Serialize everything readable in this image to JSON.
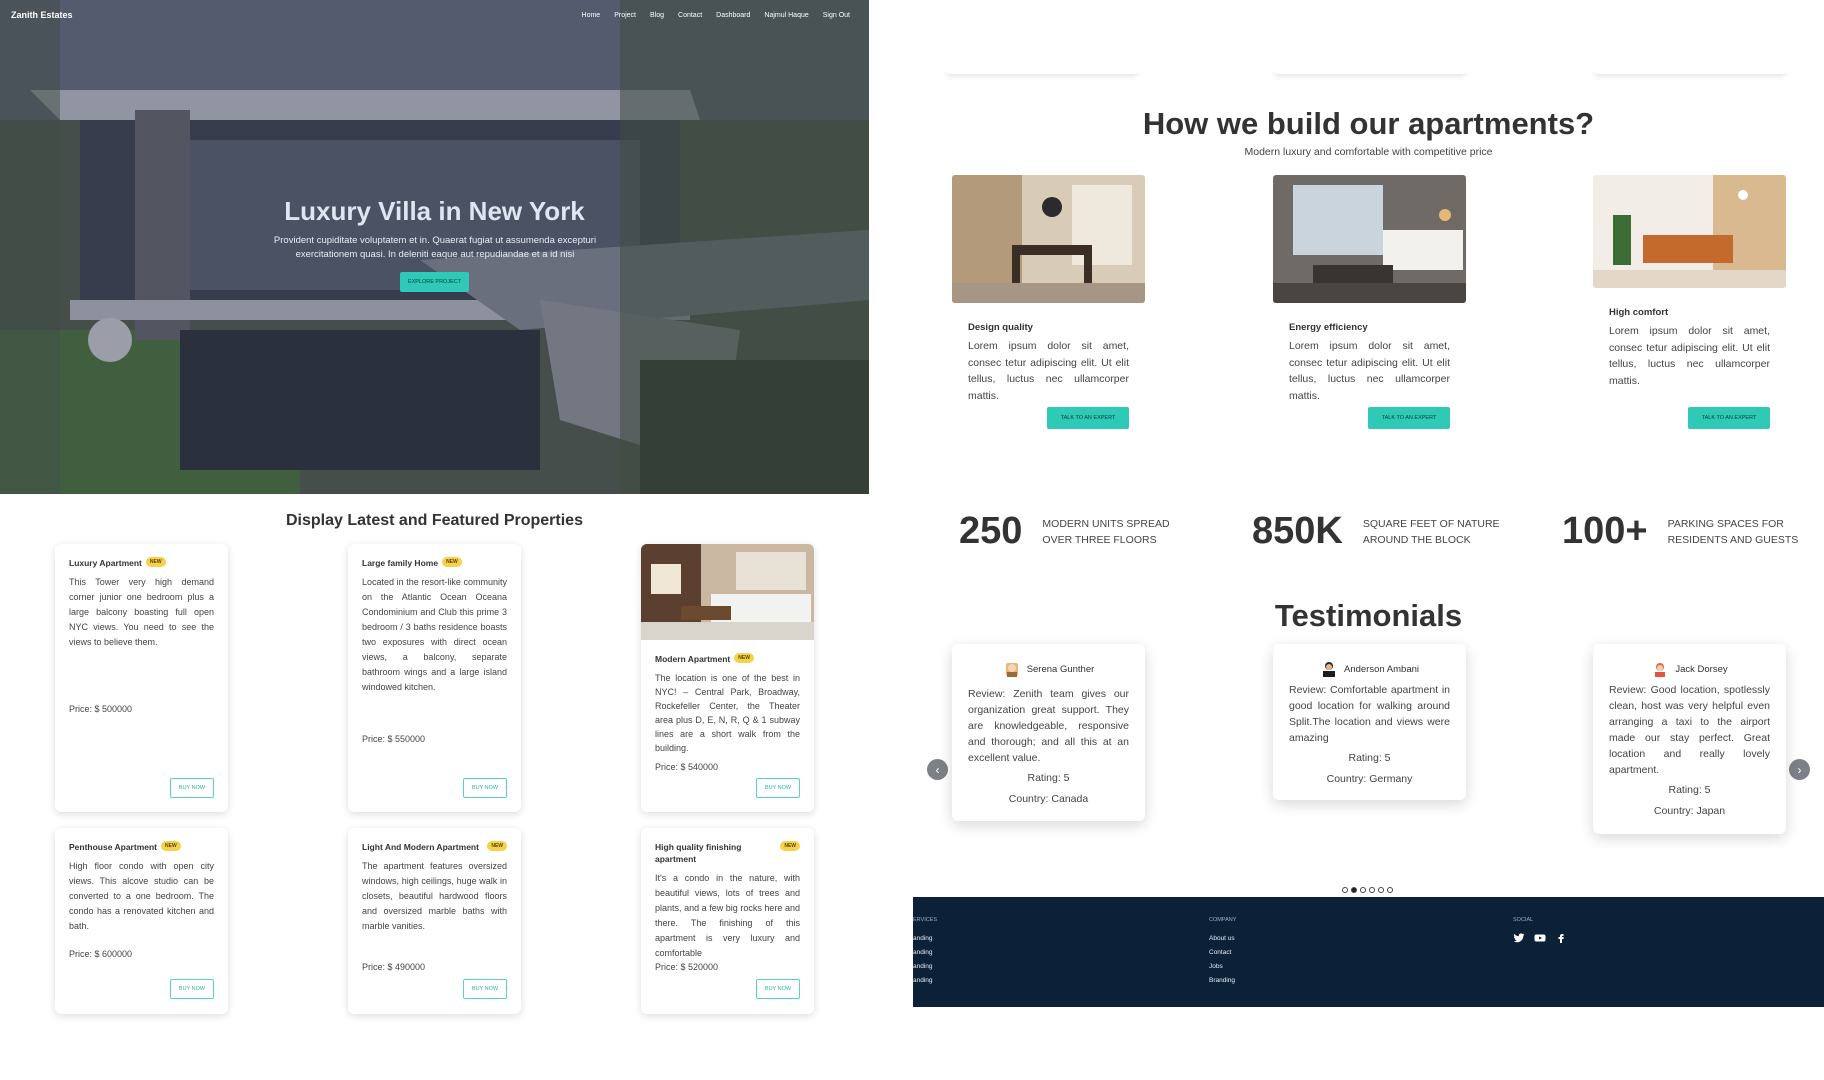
{
  "nav": {
    "brand": "Zanith Estates",
    "links": [
      "Home",
      "Project",
      "Blog",
      "Contact",
      "Dashboard",
      "Najmul Haque",
      "Sign Out"
    ]
  },
  "hero": {
    "title": "Luxury Villa in New York",
    "subtitle": "Provident cupiditate voluptatem et in. Quaerat fugiat ut assumenda excepturi exercitationem quasi. In deleniti eaque aut repudiandae et a id nisi",
    "button": "EXPLORE PROJECT"
  },
  "properties": {
    "title": "Display Latest and Featured Properties",
    "buy_label": "BUY NOW",
    "badge": "NEW",
    "items": [
      {
        "title": "Luxury Apartment",
        "desc": "This Tower very high demand corner junior one bedroom plus a large balcony boasting full open NYC views. You need to see the views to believe them.",
        "price": "Price: $ 500000"
      },
      {
        "title": "Large family Home",
        "desc": "Located in the resort-like community on the Atlantic Ocean Oceana Condominium and Club this prime 3 bedroom / 3 baths residence boasts two exposures with direct ocean views, a balcony, separate bathroom wings and a large island windowed kitchen.",
        "price": "Price: $ 550000"
      },
      {
        "title": "Modern Apartment",
        "desc": "The location is one of the best in NYC! – Central Park, Broadway, Rockefeller Center, the Theater area plus D, E, N, R, Q & 1 subway lines are a short walk from the building.",
        "price": "Price: $ 540000"
      },
      {
        "title": "Penthouse Apartment",
        "desc": "High floor condo with open city views. This alcove studio can be converted to a one bedroom. The condo has a renovated kitchen and bath.",
        "price": "Price: $ 600000"
      },
      {
        "title": "Light And Modern Apartment",
        "desc": "The apartment features oversized windows, high ceilings, huge walk in closets, beautiful hardwood floors and oversized marble baths with marble vanities.",
        "price": "Price: $ 490000"
      },
      {
        "title": "High quality finishing apartment",
        "desc": "It's a condo in the nature, with beautiful views, lots of trees and plants, and a few big rocks here and there. The finishing of this apartment is very luxury and comfortable",
        "price": "Price: $ 520000"
      }
    ]
  },
  "build": {
    "title": "How we build our apartments?",
    "subtitle": "Modern luxury and comfortable with competitive price",
    "button": "TALK TO AN EXPERT",
    "features": [
      {
        "title": "Design quality",
        "desc": "Lorem ipsum dolor sit amet, consec tetur adipiscing elit. Ut elit tellus, luctus nec ullamcorper mattis."
      },
      {
        "title": "Energy efficiency",
        "desc": "Lorem ipsum dolor sit amet, consec tetur adipiscing elit. Ut elit tellus, luctus nec ullamcorper mattis."
      },
      {
        "title": "High comfort",
        "desc": "Lorem ipsum dolor sit amet, consec tetur adipiscing elit. Ut elit tellus, luctus nec ullamcorper mattis."
      }
    ]
  },
  "stats": [
    {
      "value": "250",
      "label": "MODERN UNITS SPREAD OVER THREE FLOORS"
    },
    {
      "value": "850K",
      "label": "SQUARE FEET OF NATURE AROUND THE BLOCK"
    },
    {
      "value": "100+",
      "label": "PARKING SPACES FOR RESIDENTS AND GUESTS"
    }
  ],
  "testimonials": {
    "title": "Testimonials",
    "items": [
      {
        "name": "Serena Gunther",
        "review": "Review: Zenith team gives our organization great support. They are knowledgeable, responsive and thorough; and all this at an excellent value.",
        "rating": "Rating: 5",
        "country": "Country: Canada"
      },
      {
        "name": "Anderson Ambani",
        "review": "Review: Comfortable apartment in good location for walking around Split.The location and views were amazing",
        "rating": "Rating: 5",
        "country": "Country: Germany"
      },
      {
        "name": "Jack Dorsey",
        "review": "Review: Good location, spotlessly clean, host was very helpful even arranging a taxi to the airport made our stay perfect. Great location and really lovely apartment.",
        "rating": "Rating: 5",
        "country": "Country: Japan"
      }
    ],
    "prev": "‹",
    "next": "›"
  },
  "footer": {
    "services_heading": "ERVICES",
    "services": [
      "anding",
      "anding",
      "anding",
      "anding"
    ],
    "company_heading": "COMPANY",
    "company": [
      "About us",
      "Contact",
      "Jobs",
      "Branding"
    ],
    "social_heading": "SOCIAL",
    "social_icons": [
      "twitter-icon",
      "youtube-icon",
      "facebook-icon"
    ]
  },
  "colors": {
    "accent": "#2ec9b7",
    "badge": "#f6d24a",
    "footer": "#0b2138"
  }
}
